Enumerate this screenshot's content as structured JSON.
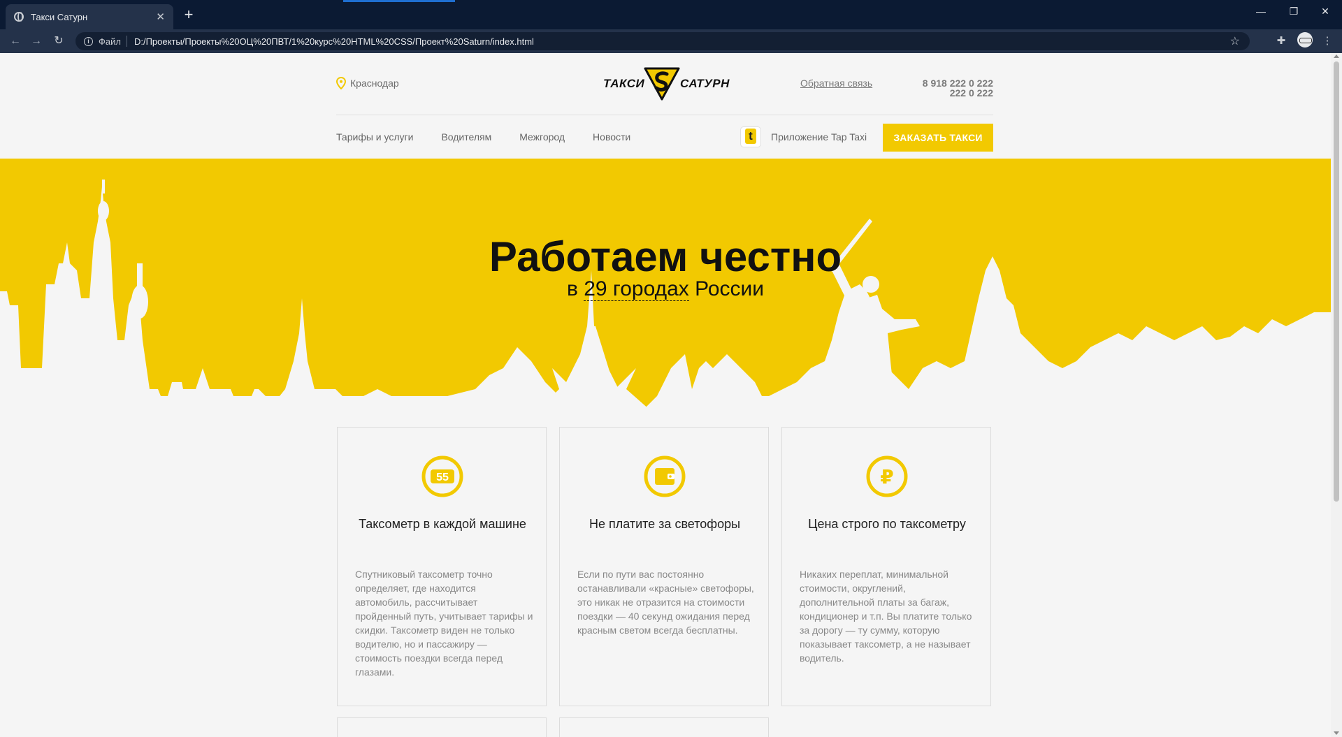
{
  "browser": {
    "tab_title": "Такси Сатурн",
    "tab_close": "✕",
    "new_tab": "+",
    "address_file_label": "Файл",
    "address_url": "D:/Проекты/Проекты%20ОЦ%20ПВТ/1%20курс%20HTML%20CSS/Проект%20Saturn/index.html",
    "window_controls": {
      "minimize": "—",
      "restore": "❐",
      "close": "✕"
    }
  },
  "header": {
    "city": "Краснодар",
    "logo_left": "ТАКСИ",
    "logo_right": "САТУРН",
    "feedback_label": "Обратная связь",
    "phones": [
      "8 918 222 0 222",
      "222 0 222"
    ]
  },
  "menu": {
    "items": [
      "Тарифы и услуги",
      "Водителям",
      "Межгород",
      "Новости"
    ],
    "app_label": "Приложение Tap Taxi",
    "order_button": "ЗАКАЗАТЬ ТАКСИ"
  },
  "hero": {
    "title": "Работаем честно",
    "sub_prefix": "в",
    "sub_cities": "29 городах",
    "sub_suffix": "России"
  },
  "features": [
    {
      "icon": "taximeter-icon",
      "icon_text": "55",
      "title": "Таксометр в каждой машине",
      "text": "Спутниковый таксометр точно определяет, где находится автомобиль, рассчитывает пройденный путь, учитывает тарифы и скидки. Таксометр виден не только водителю, но и пассажиру — стоимость поездки всегда перед глазами."
    },
    {
      "icon": "wallet-icon",
      "title": "Не платите за светофоры",
      "text": "Если по пути вас постоянно останавливали «красные» светофоры, это никак не отразится на стоимости поездки — 40 секунд ожидания перед красным светом всегда бесплатны."
    },
    {
      "icon": "ruble-icon",
      "icon_text": "₽",
      "title": "Цена строго по таксометру",
      "text": "Никаких переплат, минимальной стоимости, округлений, дополнительной платы за багаж, кондиционер и т.п. Вы платите только за дорогу — ту сумму, которую показывает таксометр, а не называет водитель."
    }
  ],
  "colors": {
    "brand_yellow": "#f2c901",
    "chrome_dark": "#0b1a33",
    "chrome_mid": "#24324a",
    "page_bg": "#f5f5f5"
  }
}
